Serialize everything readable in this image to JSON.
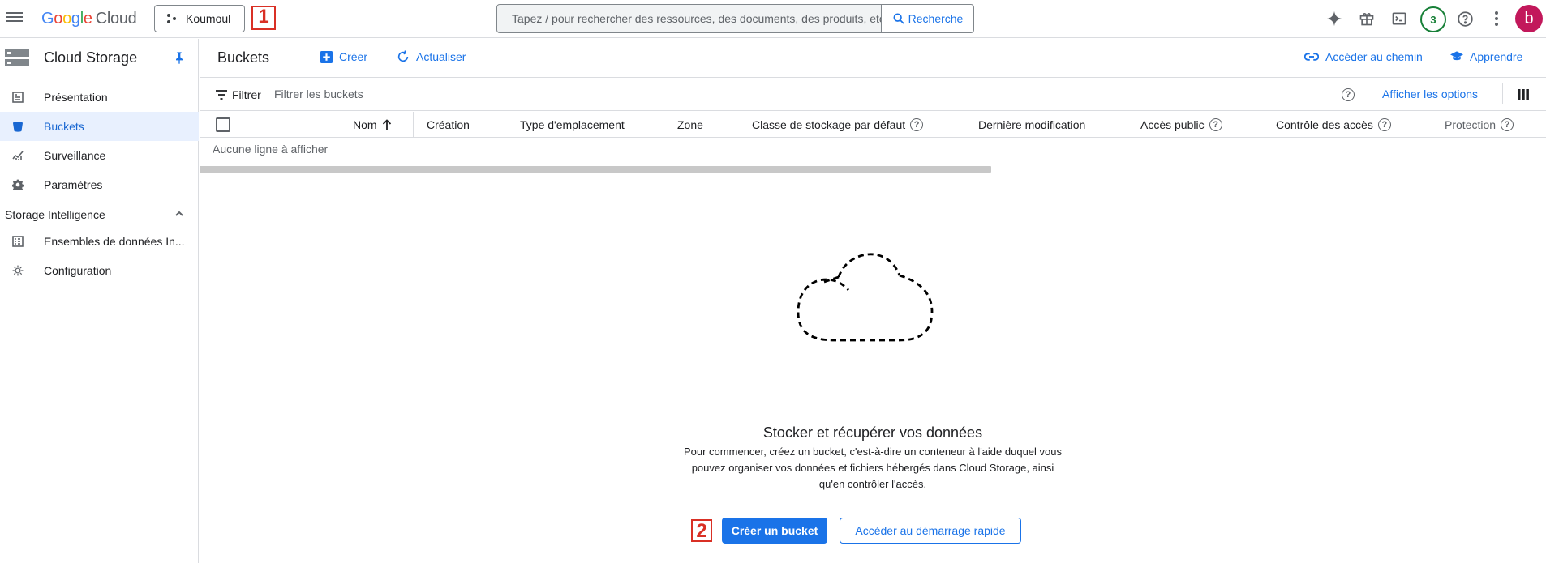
{
  "topbar": {
    "logo_parts": [
      "G",
      "o",
      "o",
      "g",
      "l",
      "e"
    ],
    "logo_cloud": "Cloud",
    "project_name": "Koumoul",
    "marker_1": "1",
    "search_placeholder": "Tapez / pour rechercher des ressources, des documents, des produits, etc",
    "search_button": "Recherche",
    "notifications_count": "3",
    "avatar_letter": "b"
  },
  "sidebar": {
    "title": "Cloud Storage",
    "items": [
      {
        "label": "Présentation",
        "icon": "dashboard-icon"
      },
      {
        "label": "Buckets",
        "icon": "bucket-icon"
      },
      {
        "label": "Surveillance",
        "icon": "chart-icon"
      },
      {
        "label": "Paramètres",
        "icon": "gear-icon"
      }
    ],
    "section_title": "Storage Intelligence",
    "section_items": [
      {
        "label": "Ensembles de données In...",
        "icon": "dataset-icon"
      },
      {
        "label": "Configuration",
        "icon": "config-icon"
      }
    ]
  },
  "main": {
    "title": "Buckets",
    "create_label": "Créer",
    "refresh_label": "Actualiser",
    "goto_path_label": "Accéder au chemin",
    "learn_label": "Apprendre",
    "filter_label": "Filtrer",
    "filter_placeholder": "Filtrer les buckets",
    "show_options_label": "Afficher les options",
    "columns": {
      "name": "Nom",
      "created": "Création",
      "location_type": "Type d'emplacement",
      "zone": "Zone",
      "storage_class": "Classe de stockage par défaut",
      "last_modified": "Dernière modification",
      "public_access": "Accès public",
      "access_control": "Contrôle des accès",
      "protection": "Protection"
    },
    "empty_row": "Aucune ligne à afficher",
    "empty_state": {
      "title": "Stocker et récupérer vos données",
      "description": "Pour commencer, créez un bucket, c'est-à-dire un conteneur à l'aide duquel vous pouvez organiser vos données et fichiers hébergés dans Cloud Storage, ainsi qu'en contrôler l'accès.",
      "marker_2": "2",
      "create_bucket_label": "Créer un bucket",
      "quickstart_label": "Accéder au démarrage rapide"
    }
  },
  "colors": {
    "accent": "#1a73e8",
    "active_bg": "#e8f0fe",
    "marker": "#d93025",
    "avatar": "#c2185b",
    "badge": "#188038"
  }
}
